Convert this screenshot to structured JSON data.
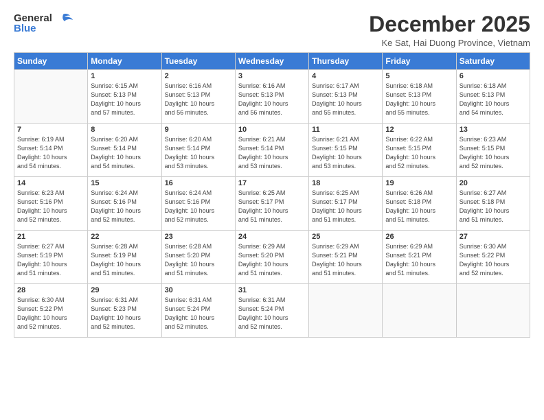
{
  "logo": {
    "line1": "General",
    "line2": "Blue"
  },
  "header": {
    "month_title": "December 2025",
    "subtitle": "Ke Sat, Hai Duong Province, Vietnam"
  },
  "weekdays": [
    "Sunday",
    "Monday",
    "Tuesday",
    "Wednesday",
    "Thursday",
    "Friday",
    "Saturday"
  ],
  "weeks": [
    [
      {
        "day": "",
        "info": ""
      },
      {
        "day": "1",
        "info": "Sunrise: 6:15 AM\nSunset: 5:13 PM\nDaylight: 10 hours\nand 57 minutes."
      },
      {
        "day": "2",
        "info": "Sunrise: 6:16 AM\nSunset: 5:13 PM\nDaylight: 10 hours\nand 56 minutes."
      },
      {
        "day": "3",
        "info": "Sunrise: 6:16 AM\nSunset: 5:13 PM\nDaylight: 10 hours\nand 56 minutes."
      },
      {
        "day": "4",
        "info": "Sunrise: 6:17 AM\nSunset: 5:13 PM\nDaylight: 10 hours\nand 55 minutes."
      },
      {
        "day": "5",
        "info": "Sunrise: 6:18 AM\nSunset: 5:13 PM\nDaylight: 10 hours\nand 55 minutes."
      },
      {
        "day": "6",
        "info": "Sunrise: 6:18 AM\nSunset: 5:13 PM\nDaylight: 10 hours\nand 54 minutes."
      }
    ],
    [
      {
        "day": "7",
        "info": "Sunrise: 6:19 AM\nSunset: 5:14 PM\nDaylight: 10 hours\nand 54 minutes."
      },
      {
        "day": "8",
        "info": "Sunrise: 6:20 AM\nSunset: 5:14 PM\nDaylight: 10 hours\nand 54 minutes."
      },
      {
        "day": "9",
        "info": "Sunrise: 6:20 AM\nSunset: 5:14 PM\nDaylight: 10 hours\nand 53 minutes."
      },
      {
        "day": "10",
        "info": "Sunrise: 6:21 AM\nSunset: 5:14 PM\nDaylight: 10 hours\nand 53 minutes."
      },
      {
        "day": "11",
        "info": "Sunrise: 6:21 AM\nSunset: 5:15 PM\nDaylight: 10 hours\nand 53 minutes."
      },
      {
        "day": "12",
        "info": "Sunrise: 6:22 AM\nSunset: 5:15 PM\nDaylight: 10 hours\nand 52 minutes."
      },
      {
        "day": "13",
        "info": "Sunrise: 6:23 AM\nSunset: 5:15 PM\nDaylight: 10 hours\nand 52 minutes."
      }
    ],
    [
      {
        "day": "14",
        "info": "Sunrise: 6:23 AM\nSunset: 5:16 PM\nDaylight: 10 hours\nand 52 minutes."
      },
      {
        "day": "15",
        "info": "Sunrise: 6:24 AM\nSunset: 5:16 PM\nDaylight: 10 hours\nand 52 minutes."
      },
      {
        "day": "16",
        "info": "Sunrise: 6:24 AM\nSunset: 5:16 PM\nDaylight: 10 hours\nand 52 minutes."
      },
      {
        "day": "17",
        "info": "Sunrise: 6:25 AM\nSunset: 5:17 PM\nDaylight: 10 hours\nand 51 minutes."
      },
      {
        "day": "18",
        "info": "Sunrise: 6:25 AM\nSunset: 5:17 PM\nDaylight: 10 hours\nand 51 minutes."
      },
      {
        "day": "19",
        "info": "Sunrise: 6:26 AM\nSunset: 5:18 PM\nDaylight: 10 hours\nand 51 minutes."
      },
      {
        "day": "20",
        "info": "Sunrise: 6:27 AM\nSunset: 5:18 PM\nDaylight: 10 hours\nand 51 minutes."
      }
    ],
    [
      {
        "day": "21",
        "info": "Sunrise: 6:27 AM\nSunset: 5:19 PM\nDaylight: 10 hours\nand 51 minutes."
      },
      {
        "day": "22",
        "info": "Sunrise: 6:28 AM\nSunset: 5:19 PM\nDaylight: 10 hours\nand 51 minutes."
      },
      {
        "day": "23",
        "info": "Sunrise: 6:28 AM\nSunset: 5:20 PM\nDaylight: 10 hours\nand 51 minutes."
      },
      {
        "day": "24",
        "info": "Sunrise: 6:29 AM\nSunset: 5:20 PM\nDaylight: 10 hours\nand 51 minutes."
      },
      {
        "day": "25",
        "info": "Sunrise: 6:29 AM\nSunset: 5:21 PM\nDaylight: 10 hours\nand 51 minutes."
      },
      {
        "day": "26",
        "info": "Sunrise: 6:29 AM\nSunset: 5:21 PM\nDaylight: 10 hours\nand 51 minutes."
      },
      {
        "day": "27",
        "info": "Sunrise: 6:30 AM\nSunset: 5:22 PM\nDaylight: 10 hours\nand 52 minutes."
      }
    ],
    [
      {
        "day": "28",
        "info": "Sunrise: 6:30 AM\nSunset: 5:22 PM\nDaylight: 10 hours\nand 52 minutes."
      },
      {
        "day": "29",
        "info": "Sunrise: 6:31 AM\nSunset: 5:23 PM\nDaylight: 10 hours\nand 52 minutes."
      },
      {
        "day": "30",
        "info": "Sunrise: 6:31 AM\nSunset: 5:24 PM\nDaylight: 10 hours\nand 52 minutes."
      },
      {
        "day": "31",
        "info": "Sunrise: 6:31 AM\nSunset: 5:24 PM\nDaylight: 10 hours\nand 52 minutes."
      },
      {
        "day": "",
        "info": ""
      },
      {
        "day": "",
        "info": ""
      },
      {
        "day": "",
        "info": ""
      }
    ]
  ]
}
